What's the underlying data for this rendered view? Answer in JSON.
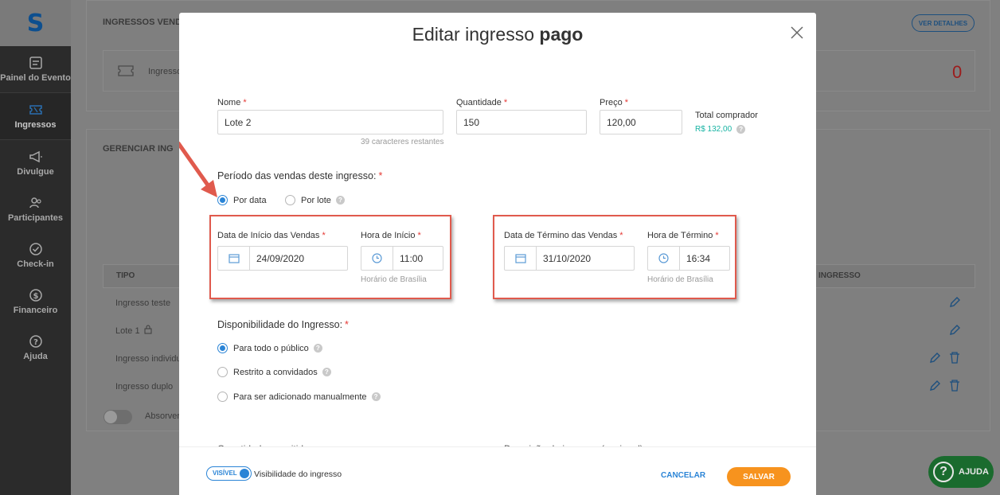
{
  "sidebar": {
    "logo": "S",
    "items": [
      {
        "label": "Painel do Evento",
        "icon": "document-icon"
      },
      {
        "label": "Ingressos",
        "icon": "ticket-icon"
      },
      {
        "label": "Divulgue",
        "icon": "megaphone-icon"
      },
      {
        "label": "Participantes",
        "icon": "people-icon"
      },
      {
        "label": "Check-in",
        "icon": "check-circle-icon"
      },
      {
        "label": "Financeiro",
        "icon": "dollar-circle-icon"
      },
      {
        "label": "Ajuda",
        "icon": "question-circle-icon"
      }
    ]
  },
  "background": {
    "section1_title": "INGRESSOS VENDI",
    "details_button": "VER DETALHES",
    "tickets_label": "Ingresso",
    "tickets_count": "0",
    "section2_title": "GERENCIAR ING",
    "col_tipo": "TIPO",
    "col_ingresso": "INGRESSO",
    "rows": [
      "Ingresso teste",
      "Lote 1",
      "Ingresso individu",
      "Ingresso duplo"
    ],
    "toggle_label": "Absorver",
    "help_button": "AJUDA"
  },
  "modal": {
    "title_prefix": "Editar ingresso",
    "title_bold": "pago",
    "name_label": "Nome",
    "name_value": "Lote 2",
    "name_hint": "39 caracteres restantes",
    "qty_label": "Quantidade",
    "qty_value": "150",
    "price_label": "Preço",
    "price_value": "120,00",
    "total_label": "Total comprador",
    "total_value": "R$ 132,00",
    "period_title": "Período das vendas deste ingresso:",
    "period_by_date": "Por data",
    "period_by_lot": "Por lote",
    "start_date_label": "Data de Início das Vendas",
    "start_date_value": "24/09/2020",
    "start_time_label": "Hora de Início",
    "start_time_value": "11:00",
    "timezone_hint": "Horário de Brasília",
    "end_date_label": "Data de Término das Vendas",
    "end_date_value": "31/10/2020",
    "end_time_label": "Hora de Término",
    "end_time_value": "16:34",
    "availability_title": "Disponibilidade do Ingresso:",
    "avail_public": "Para todo o público",
    "avail_invited": "Restrito a convidados",
    "avail_manual": "Para ser adicionado manualmente",
    "cut_left": "Quantidade permitida",
    "cut_right": "Descrição do ingresso (opcional)",
    "visible_toggle": "VISÍVEL",
    "visibility_label": "Visibilidade do ingresso",
    "cancel": "CANCELAR",
    "save": "SALVAR"
  },
  "colors": {
    "accent": "#2a84d6",
    "save": "#f7931e",
    "highlight": "#e05a4d",
    "total": "#17b3a3"
  }
}
